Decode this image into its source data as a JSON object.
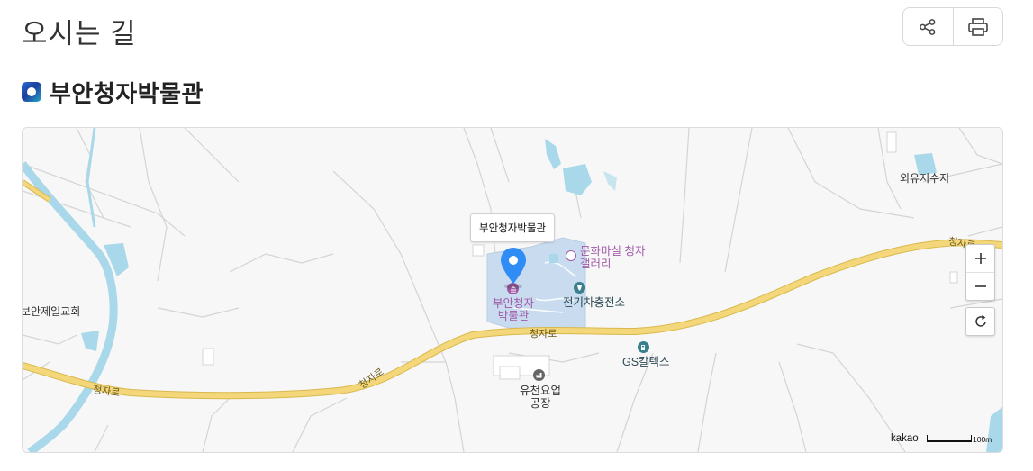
{
  "header": {
    "title": "오시는 길",
    "share_icon": "share-icon",
    "print_icon": "print-icon"
  },
  "section": {
    "title": "부안청자박물관",
    "icon": "place-icon"
  },
  "map": {
    "marker_tooltip": "부안청자박물관",
    "places": {
      "reservoir": "외유저수지",
      "church": "보안제일교회",
      "gallery": "문화마실 청자\n갤러리",
      "museum": "부안청자\n박물관",
      "ev_station": "전기차충전소",
      "gas_station": "GS칼텍스",
      "factory": "유천요업\n공장"
    },
    "roads": {
      "label_left": "청자로",
      "label_center_left": "청자로",
      "label_center": "청자로",
      "label_right": "청자로"
    },
    "controls": {
      "zoom_in": "+",
      "zoom_out": "−",
      "reset_icon": "refresh-icon"
    },
    "brand": "kakao",
    "scale": "100m",
    "colors": {
      "road": "#f3d77a",
      "road_edge": "#d9b94d",
      "water": "#a9d8ea",
      "marker": "#2f8df5",
      "museum_area": "#c9dcef",
      "poi_purple": "#a05aa8",
      "poi_teal": "#3a7f8c"
    }
  }
}
